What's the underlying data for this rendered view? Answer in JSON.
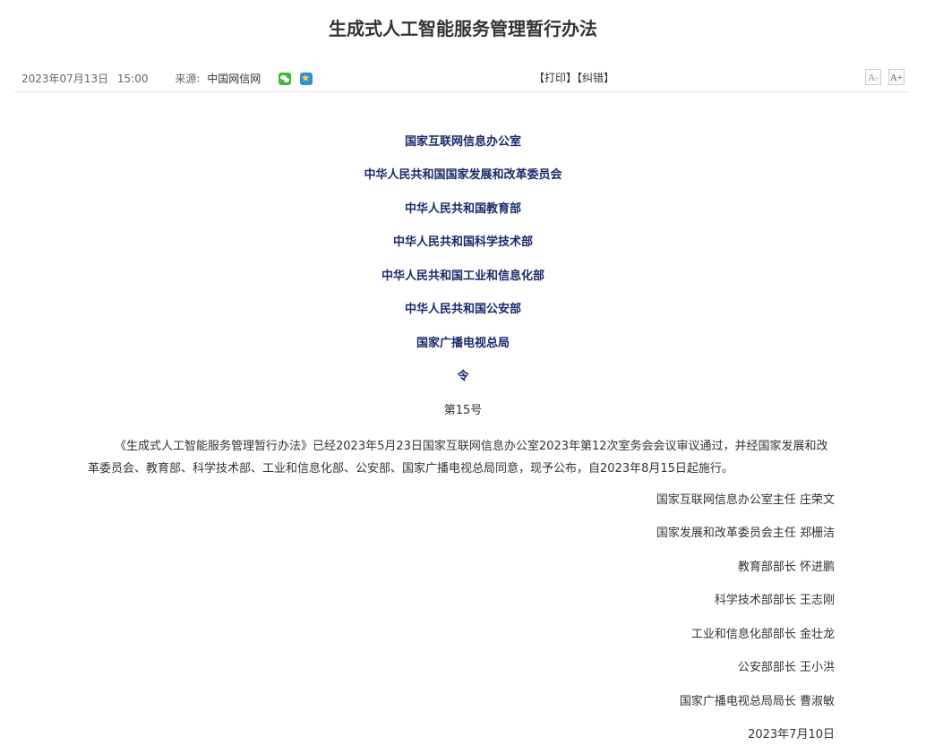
{
  "article": {
    "title": "生成式人工智能服务管理暂行办法"
  },
  "meta": {
    "date": "2023年07月13日",
    "time": "15:00",
    "source_label": "来源:",
    "source": "中国网信网",
    "print_correct": "【打印】【纠错】",
    "font_small": "A-",
    "font_large": "A+"
  },
  "agencies": [
    "国家互联网信息办公室",
    "中华人民共和国国家发展和改革委员会",
    "中华人民共和国教育部",
    "中华人民共和国科学技术部",
    "中华人民共和国工业和信息化部",
    "中华人民共和国公安部",
    "国家广播电视总局"
  ],
  "order": {
    "label": "令",
    "number": "第15号"
  },
  "body": "《生成式人工智能服务管理暂行办法》已经2023年5月23日国家互联网信息办公室2023年第12次室务会会议审议通过，并经国家发展和改革委员会、教育部、科学技术部、工业和信息化部、公安部、国家广播电视总局同意，现予公布，自2023年8月15日起施行。",
  "signers": [
    "国家互联网信息办公室主任 庄荣文",
    "国家发展和改革委员会主任 郑栅洁",
    "教育部部长 怀进鹏",
    "科学技术部部长 王志刚",
    "工业和信息化部部长 金壮龙",
    "公安部部长 王小洪",
    "国家广播电视总局局长 曹淑敏",
    "2023年7月10日"
  ],
  "icons": {
    "share_wechat": "wechat-icon",
    "share_qzone": "qzone-icon"
  },
  "colors": {
    "agency_text": "#1a2a6c",
    "body_text": "#333333",
    "wechat": "#3dbb3d",
    "qzone": "#2f8fdb"
  }
}
